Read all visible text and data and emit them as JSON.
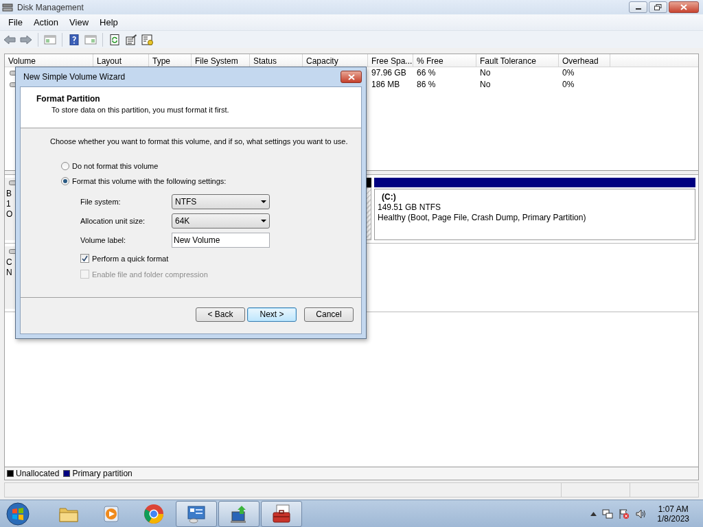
{
  "window": {
    "title": "Disk Management"
  },
  "menu": [
    "File",
    "Action",
    "View",
    "Help"
  ],
  "volume_table": {
    "columns": [
      "Volume",
      "Layout",
      "Type",
      "File System",
      "Status",
      "Capacity",
      "Free Spa...",
      "% Free",
      "Fault Tolerance",
      "Overhead"
    ],
    "rows": [
      {
        "free_space": "97.96 GB",
        "percent_free": "66 %",
        "fault_tolerance": "No",
        "overhead": "0%"
      },
      {
        "free_space": "186 MB",
        "percent_free": "86 %",
        "fault_tolerance": "No",
        "overhead": "0%"
      }
    ]
  },
  "disks": [
    {
      "label_lines": [
        "B",
        "1",
        "O"
      ],
      "segments": [
        {
          "kind": "unallocated",
          "color": "#000000"
        },
        {
          "kind": "primary",
          "color": "#000080",
          "name": "(C:)",
          "size": "149.51 GB NTFS",
          "status": "Healthy (Boot, Page File, Crash Dump, Primary Partition)"
        }
      ]
    },
    {
      "label_lines": [
        "C",
        "N"
      ]
    }
  ],
  "legend": [
    {
      "label": "Unallocated",
      "color": "#000000"
    },
    {
      "label": "Primary partition",
      "color": "#000080"
    }
  ],
  "dialog": {
    "title": "New Simple Volume Wizard",
    "header_title": "Format Partition",
    "header_subtitle": "To store data on this partition, you must format it first.",
    "instruction": "Choose whether you want to format this volume, and if so, what settings you want to use.",
    "options": [
      {
        "label": "Do not format this volume",
        "selected": false
      },
      {
        "label": "Format this volume with the following settings:",
        "selected": true
      }
    ],
    "fields": [
      {
        "kind": "dropdown",
        "label": "File system:",
        "value": "NTFS"
      },
      {
        "kind": "dropdown",
        "label": "Allocation unit size:",
        "value": "64K"
      },
      {
        "kind": "text",
        "label": "Volume label:",
        "value": "New Volume"
      }
    ],
    "checkboxes": [
      {
        "label": "Perform a quick format",
        "checked": true,
        "disabled": false
      },
      {
        "label": "Enable file and folder compression",
        "checked": false,
        "disabled": true
      }
    ],
    "buttons": [
      {
        "label": "< Back",
        "default": false
      },
      {
        "label": "Next >",
        "default": true
      },
      {
        "label": "Cancel",
        "default": false
      }
    ]
  },
  "taskbar": {
    "items": [
      {
        "kind": "folder",
        "active": false
      },
      {
        "kind": "media",
        "active": false
      },
      {
        "kind": "browser",
        "active": false
      },
      {
        "kind": "panel",
        "active": true
      },
      {
        "kind": "network",
        "active": true
      },
      {
        "kind": "toolbox",
        "active": true
      }
    ],
    "time": "1:07 AM",
    "date": "1/8/2023"
  }
}
